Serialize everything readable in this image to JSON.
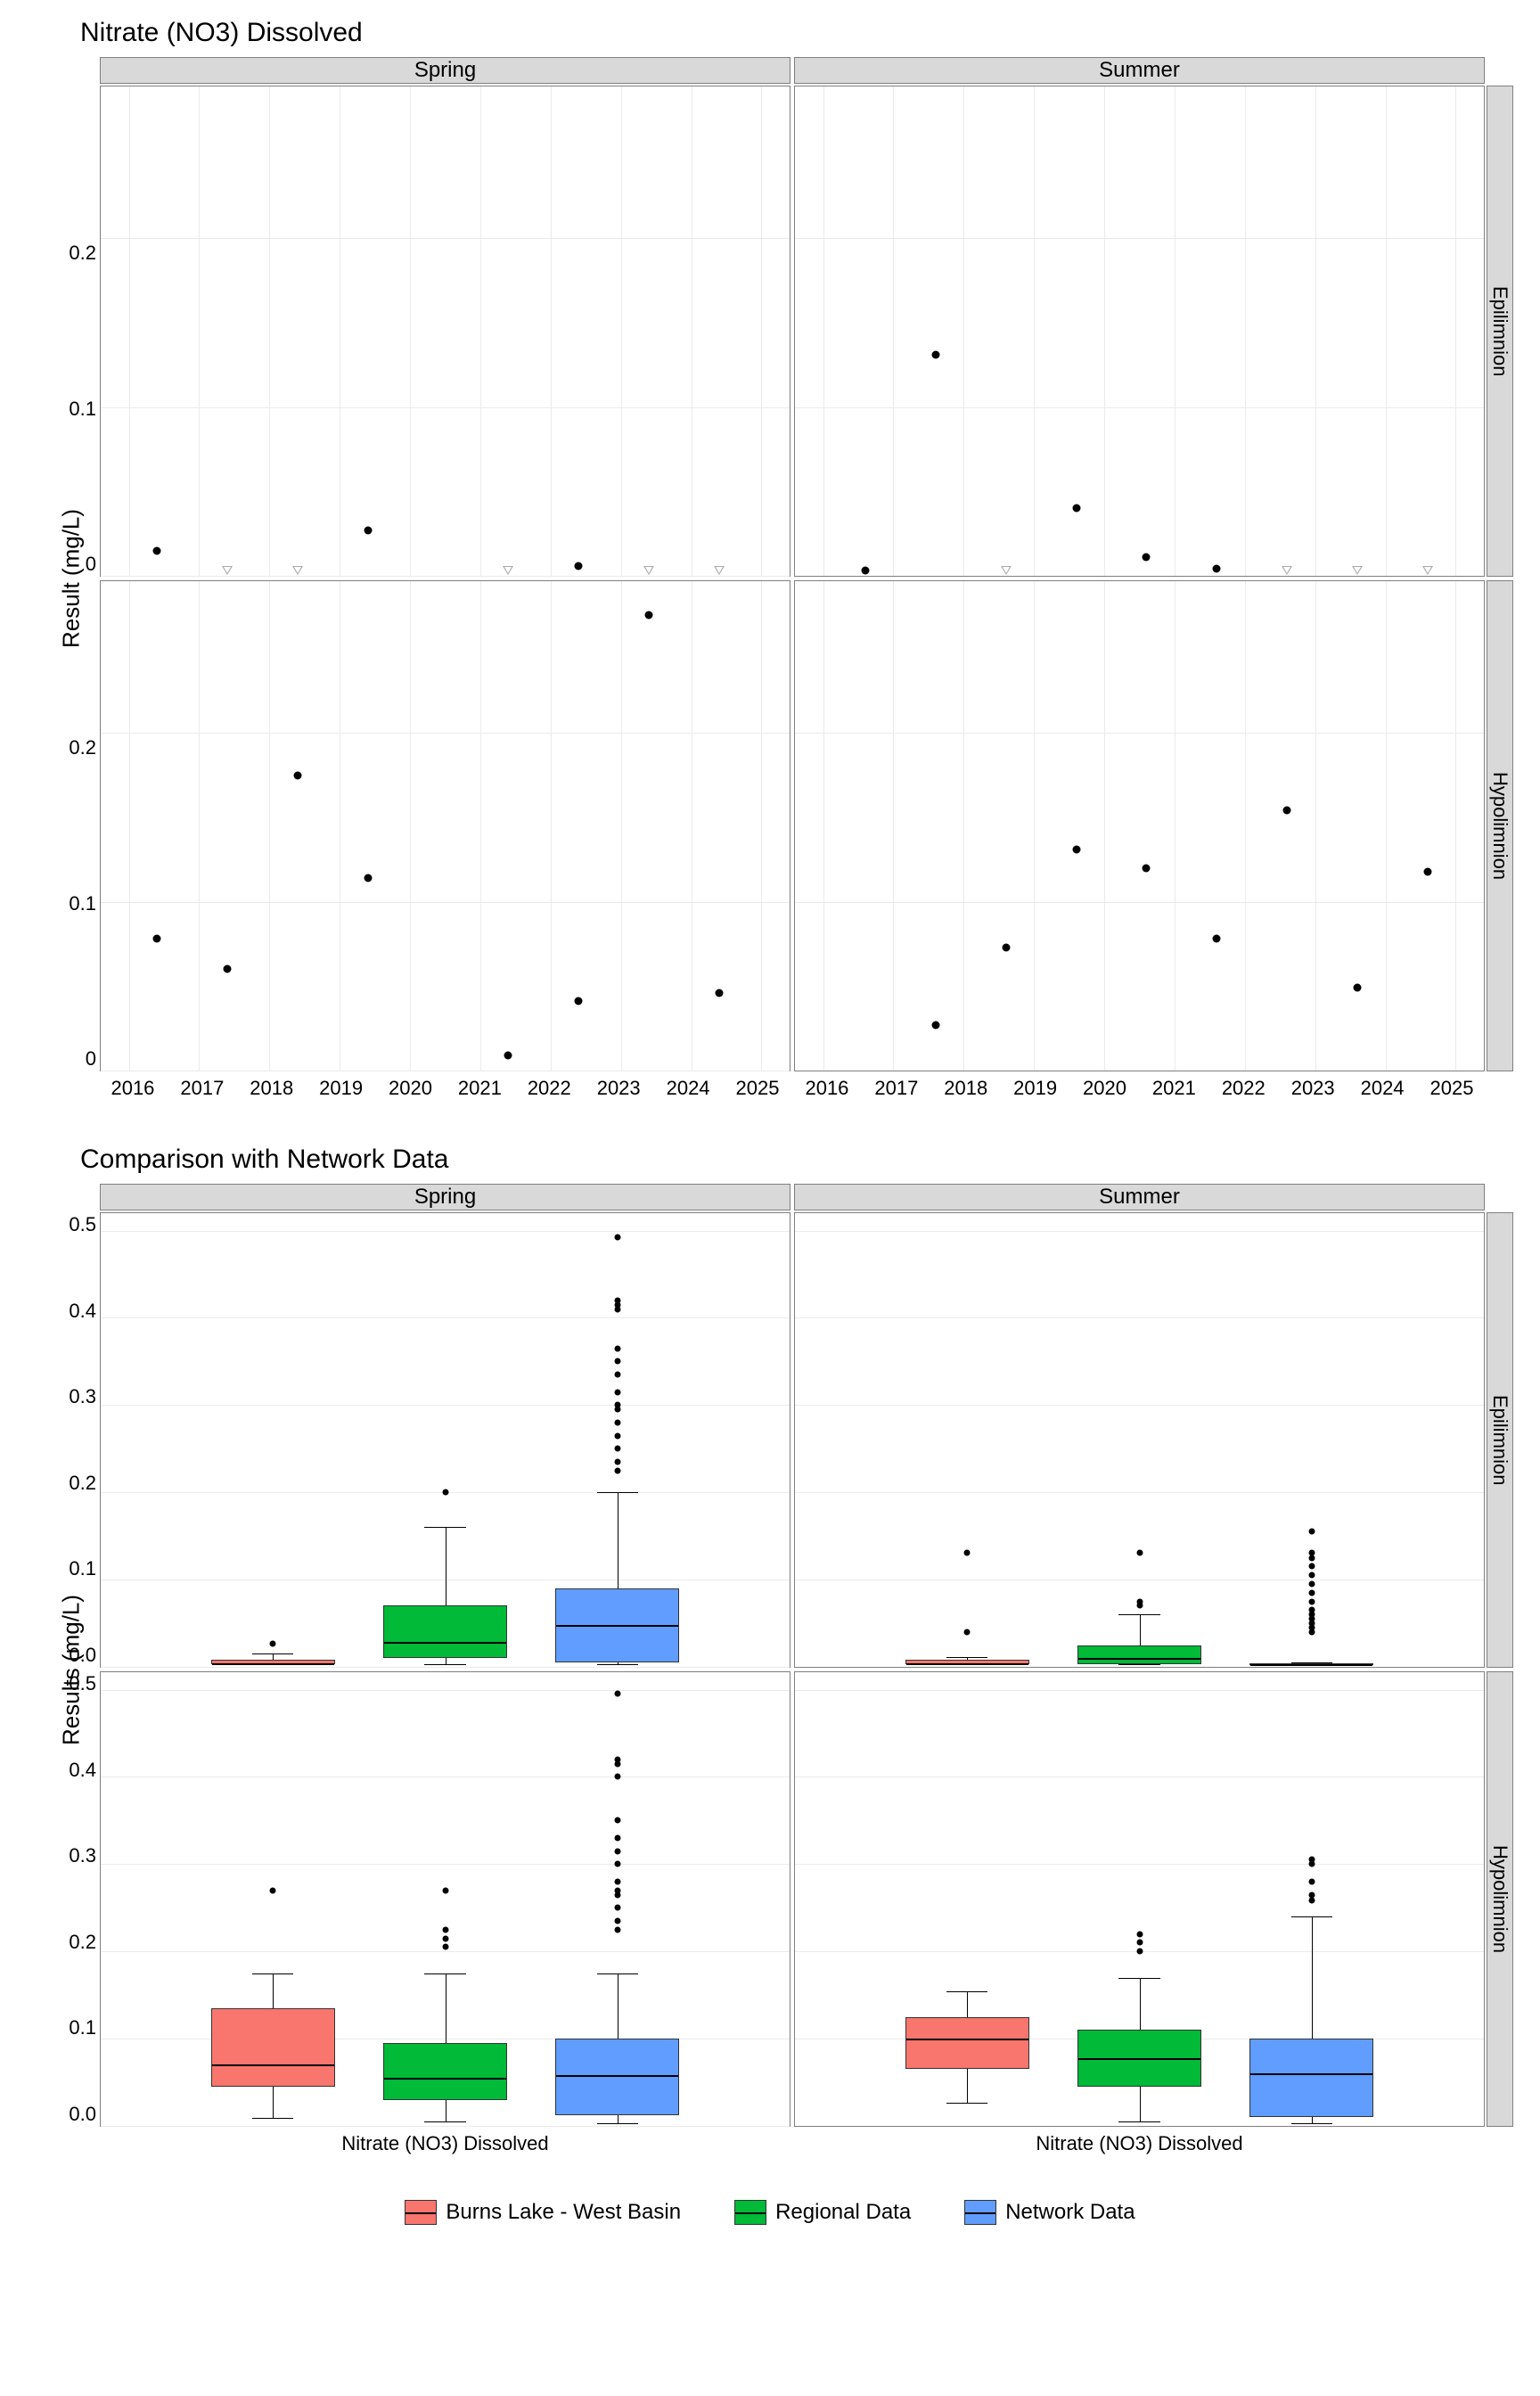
{
  "chart_data": [
    {
      "type": "scatter",
      "title": "Nitrate (NO3) Dissolved",
      "ylabel": "Result (mg/L)",
      "xlabel": "",
      "facets_col": [
        "Spring",
        "Summer"
      ],
      "facets_row": [
        "Epilimnion",
        "Hypolimnion"
      ],
      "x_ticks": [
        2016,
        2017,
        2018,
        2019,
        2020,
        2021,
        2022,
        2023,
        2024,
        2025
      ],
      "y_ticks": [
        0.0,
        0.1,
        0.2
      ],
      "ylim": [
        0,
        0.29
      ],
      "xlim": [
        2015.6,
        2025.4
      ],
      "panels": {
        "Spring_Epilimnion": {
          "detected": [
            {
              "x": 2016.4,
              "y": 0.015
            },
            {
              "x": 2019.4,
              "y": 0.027
            },
            {
              "x": 2022.4,
              "y": 0.006
            }
          ],
          "nondetect": [
            {
              "x": 2017.4,
              "y": 0.003
            },
            {
              "x": 2018.4,
              "y": 0.003
            },
            {
              "x": 2021.4,
              "y": 0.003
            },
            {
              "x": 2023.4,
              "y": 0.003
            },
            {
              "x": 2024.4,
              "y": 0.003
            }
          ]
        },
        "Summer_Epilimnion": {
          "detected": [
            {
              "x": 2016.6,
              "y": 0.003
            },
            {
              "x": 2017.6,
              "y": 0.131
            },
            {
              "x": 2019.6,
              "y": 0.04
            },
            {
              "x": 2020.6,
              "y": 0.011
            },
            {
              "x": 2021.6,
              "y": 0.004
            }
          ],
          "nondetect": [
            {
              "x": 2018.6,
              "y": 0.003
            },
            {
              "x": 2022.6,
              "y": 0.003
            },
            {
              "x": 2023.6,
              "y": 0.003
            },
            {
              "x": 2024.6,
              "y": 0.003
            }
          ]
        },
        "Spring_Hypolimnion": {
          "detected": [
            {
              "x": 2016.4,
              "y": 0.078
            },
            {
              "x": 2017.4,
              "y": 0.06
            },
            {
              "x": 2018.4,
              "y": 0.175
            },
            {
              "x": 2019.4,
              "y": 0.114
            },
            {
              "x": 2021.4,
              "y": 0.009
            },
            {
              "x": 2022.4,
              "y": 0.041
            },
            {
              "x": 2023.4,
              "y": 0.27
            },
            {
              "x": 2024.4,
              "y": 0.046
            }
          ],
          "nondetect": []
        },
        "Summer_Hypolimnion": {
          "detected": [
            {
              "x": 2017.6,
              "y": 0.027
            },
            {
              "x": 2018.6,
              "y": 0.073
            },
            {
              "x": 2019.6,
              "y": 0.131
            },
            {
              "x": 2020.6,
              "y": 0.12
            },
            {
              "x": 2021.6,
              "y": 0.078
            },
            {
              "x": 2022.6,
              "y": 0.154
            },
            {
              "x": 2023.6,
              "y": 0.049
            },
            {
              "x": 2024.6,
              "y": 0.118
            }
          ],
          "nondetect": []
        }
      }
    },
    {
      "type": "boxplot",
      "title": "Comparison with Network Data",
      "ylabel": "Results (mg/L)",
      "xlabel": "Nitrate (NO3) Dissolved",
      "facets_col": [
        "Spring",
        "Summer"
      ],
      "facets_row": [
        "Epilimnion",
        "Hypolimnion"
      ],
      "y_ticks": [
        0.0,
        0.1,
        0.2,
        0.3,
        0.4,
        0.5
      ],
      "ylim": [
        0,
        0.52
      ],
      "legend": [
        "Burns Lake - West Basin",
        "Regional Data",
        "Network Data"
      ],
      "colors": {
        "Burns Lake - West Basin": "#f8766d",
        "Regional Data": "#00ba38",
        "Network Data": "#619cff"
      },
      "panels": {
        "Spring_Epilimnion": {
          "boxes": [
            {
              "group": "Burns Lake - West Basin",
              "min": 0.003,
              "q1": 0.003,
              "median": 0.003,
              "q3": 0.008,
              "max": 0.015,
              "outliers": [
                0.027
              ]
            },
            {
              "group": "Regional Data",
              "min": 0.003,
              "q1": 0.01,
              "median": 0.028,
              "q3": 0.07,
              "max": 0.16,
              "outliers": [
                0.2
              ]
            },
            {
              "group": "Network Data",
              "min": 0.003,
              "q1": 0.005,
              "median": 0.048,
              "q3": 0.09,
              "max": 0.2,
              "outliers": [
                0.225,
                0.235,
                0.25,
                0.265,
                0.28,
                0.295,
                0.3,
                0.315,
                0.335,
                0.35,
                0.365,
                0.41,
                0.415,
                0.42,
                0.492
              ]
            }
          ]
        },
        "Summer_Epilimnion": {
          "boxes": [
            {
              "group": "Burns Lake - West Basin",
              "min": 0.003,
              "q1": 0.003,
              "median": 0.003,
              "q3": 0.008,
              "max": 0.011,
              "outliers": [
                0.04,
                0.131
              ]
            },
            {
              "group": "Regional Data",
              "min": 0.003,
              "q1": 0.003,
              "median": 0.01,
              "q3": 0.025,
              "max": 0.06,
              "outliers": [
                0.07,
                0.075,
                0.131
              ]
            },
            {
              "group": "Network Data",
              "min": 0.003,
              "q1": 0.003,
              "median": 0.003,
              "q3": 0.004,
              "max": 0.005,
              "outliers": [
                0.04,
                0.045,
                0.05,
                0.055,
                0.06,
                0.065,
                0.075,
                0.085,
                0.095,
                0.105,
                0.115,
                0.125,
                0.131,
                0.155
              ]
            }
          ]
        },
        "Spring_Hypolimnion": {
          "boxes": [
            {
              "group": "Burns Lake - West Basin",
              "min": 0.009,
              "q1": 0.045,
              "median": 0.07,
              "q3": 0.135,
              "max": 0.175,
              "outliers": [
                0.27
              ]
            },
            {
              "group": "Regional Data",
              "min": 0.005,
              "q1": 0.03,
              "median": 0.055,
              "q3": 0.095,
              "max": 0.175,
              "outliers": [
                0.205,
                0.215,
                0.225,
                0.27
              ]
            },
            {
              "group": "Network Data",
              "min": 0.003,
              "q1": 0.012,
              "median": 0.058,
              "q3": 0.1,
              "max": 0.175,
              "outliers": [
                0.225,
                0.235,
                0.25,
                0.265,
                0.27,
                0.28,
                0.3,
                0.315,
                0.33,
                0.35,
                0.4,
                0.415,
                0.42,
                0.495
              ]
            }
          ]
        },
        "Summer_Hypolimnion": {
          "boxes": [
            {
              "group": "Burns Lake - West Basin",
              "min": 0.027,
              "q1": 0.065,
              "median": 0.1,
              "q3": 0.125,
              "max": 0.154,
              "outliers": []
            },
            {
              "group": "Regional Data",
              "min": 0.005,
              "q1": 0.045,
              "median": 0.078,
              "q3": 0.11,
              "max": 0.17,
              "outliers": [
                0.2,
                0.21,
                0.22
              ]
            },
            {
              "group": "Network Data",
              "min": 0.003,
              "q1": 0.01,
              "median": 0.06,
              "q3": 0.1,
              "max": 0.24,
              "outliers": [
                0.258,
                0.265,
                0.28,
                0.3,
                0.305
              ]
            }
          ]
        }
      }
    }
  ]
}
